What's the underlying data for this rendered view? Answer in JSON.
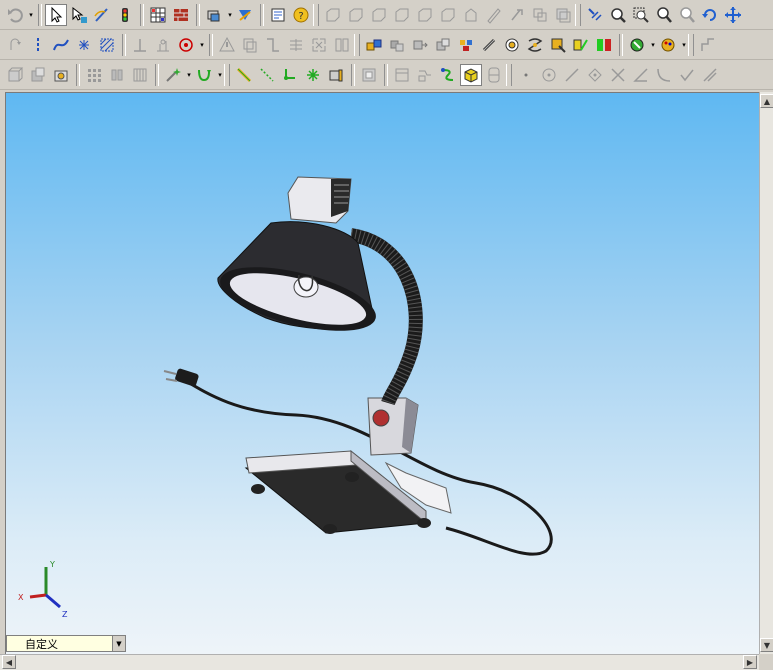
{
  "toolbar_row1": {
    "icons": [
      "undo-icon",
      "select-arrow-icon",
      "select-filter-icon",
      "sketch-icon",
      "traffic-light-icon",
      "grid-icon",
      "brick-wall-icon",
      "display-style-icon",
      "rebuild-icon",
      "notes-icon",
      "help-icon",
      "plane-icon",
      "plane2-icon",
      "plane3-icon",
      "plane4-icon",
      "plane5-icon",
      "plane6-icon",
      "plane7-icon",
      "pencil-icon",
      "sketch-relation-icon",
      "layers-icon",
      "layers2-icon",
      "zoom-fit-icon",
      "zoom-area-icon",
      "zoom-window-icon",
      "zoom-in-icon",
      "zoom-out-icon",
      "rotate-icon",
      "pan-icon"
    ]
  },
  "toolbar_row2": {
    "icons": [
      "arc-icon",
      "centerline-icon",
      "spline-icon",
      "point-icon",
      "hatch-icon",
      "dimension-base-icon",
      "dimension-icon",
      "circle-target-icon",
      "warning-icon",
      "copy-icon",
      "extend-icon",
      "trim-icon",
      "offset-icon",
      "assembly-icon",
      "component-icon",
      "mate-icon",
      "move-icon",
      "pin-icon",
      "explode-icon",
      "smart-fastener-icon",
      "toolbox-icon",
      "motion-icon",
      "color-wheel-icon",
      "appearance-icon",
      "sketch-corner-icon"
    ]
  },
  "toolbar_row3": {
    "icons": [
      "box-icon",
      "box2-icon",
      "gear-box-icon",
      "pattern-icon",
      "mirror-icon",
      "library-icon",
      "star-magic-icon",
      "loop-icon",
      "ruler-icon",
      "line-icon",
      "node-icon",
      "asterisk-icon",
      "battery-icon",
      "frame-icon",
      "frame2-icon",
      "drawing-icon",
      "route-icon",
      "cube-icon",
      "section-icon",
      "dot-icon",
      "circle-icon",
      "line-draw-icon",
      "diamond-icon",
      "cross-icon",
      "angle-icon",
      "curve-icon",
      "check-icon",
      "slash-icon"
    ]
  },
  "view_selector": {
    "value": "自定义"
  },
  "triad": {
    "x_label": "X",
    "y_label": "Y",
    "z_label": "Z"
  }
}
